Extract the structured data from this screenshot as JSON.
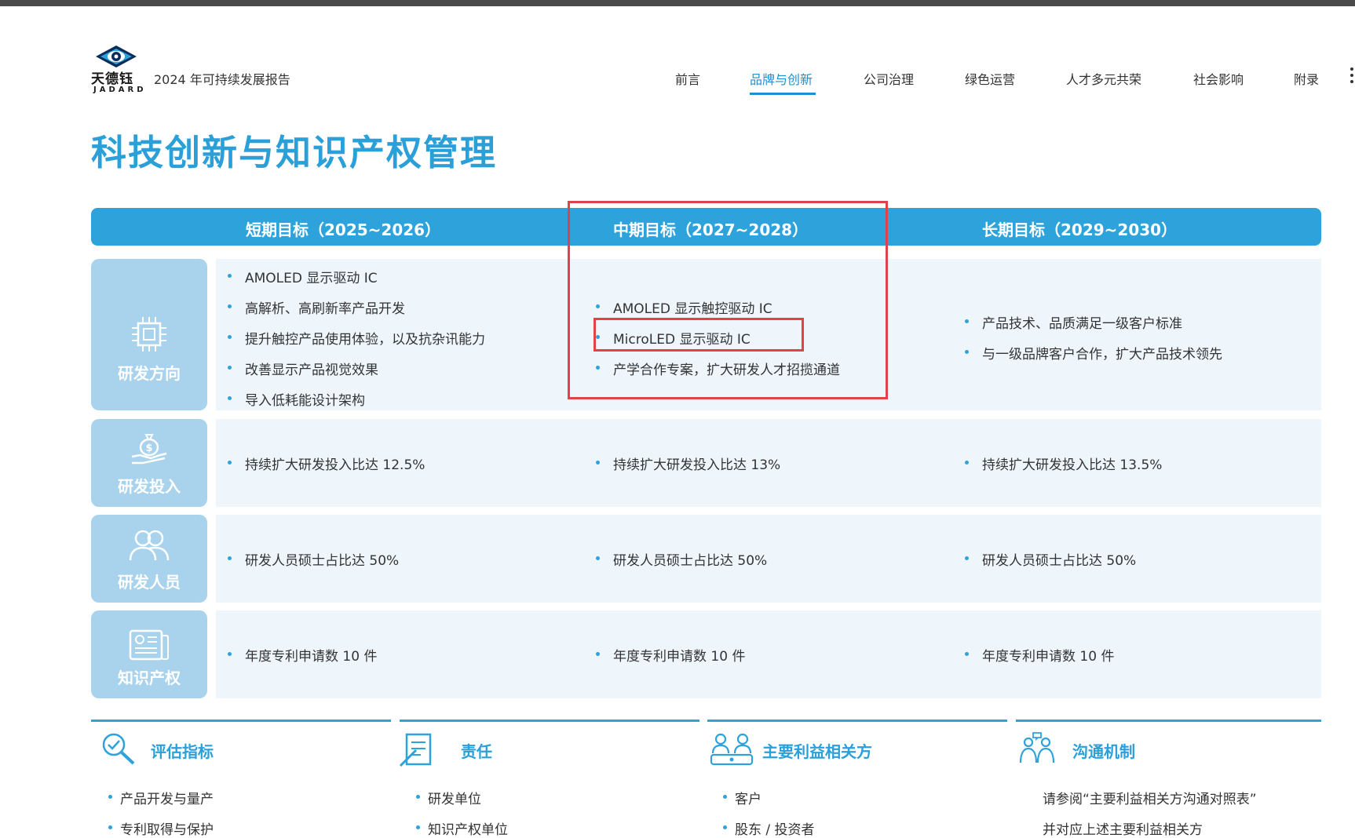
{
  "header": {
    "logo_text": "天德钰",
    "logo_sub": "JADARD",
    "report_title": "2024 年可持续发展报告"
  },
  "nav": {
    "items": [
      "前言",
      "品牌与创新",
      "公司治理",
      "绿色运营",
      "人才多元共荣",
      "社会影响",
      "附录"
    ],
    "active_index": 1
  },
  "page_title": "科技创新与知识产权管理",
  "table": {
    "columns": [
      "短期目标（2025~2026）",
      "中期目标（2027~2028）",
      "长期目标（2029~2030）"
    ],
    "rows": [
      {
        "label": "研发方向",
        "icon": "chip-icon",
        "short": [
          "AMOLED 显示驱动 IC",
          "高解析、高刷新率产品开发",
          "提升触控产品使用体验，以及抗杂讯能力",
          "改善显示产品视觉效果",
          "导入低耗能设计架构"
        ],
        "mid": [
          "AMOLED 显示触控驱动 IC",
          "MicroLED 显示驱动 IC",
          "产学合作专案，扩大研发人才招揽通道"
        ],
        "long": [
          "产品技术、品质满足一级客户标准",
          "与一级品牌客户合作，扩大产品技术领先"
        ]
      },
      {
        "label": "研发投入",
        "icon": "money-bag-hand-icon",
        "short": [
          "持续扩大研发投入比达 12.5%"
        ],
        "mid": [
          "持续扩大研发投入比达 13%"
        ],
        "long": [
          "持续扩大研发投入比达 13.5%"
        ]
      },
      {
        "label": "研发人员",
        "icon": "people-icon",
        "short": [
          "研发人员硕士占比达 50%"
        ],
        "mid": [
          "研发人员硕士占比达 50%"
        ],
        "long": [
          "研发人员硕士占比达 50%"
        ]
      },
      {
        "label": "知识产权",
        "icon": "document-icon",
        "short": [
          "年度专利申请数 10 件"
        ],
        "mid": [
          "年度专利申请数 10 件"
        ],
        "long": [
          "年度专利申请数 10 件"
        ]
      }
    ]
  },
  "sections": [
    {
      "title": "评估指标",
      "icon": "magnifier-check-icon",
      "items": [
        "产品开发与量产",
        "专利取得与保护"
      ]
    },
    {
      "title": "责任",
      "icon": "clipboard-pen-icon",
      "items": [
        "研发单位",
        "知识产权单位"
      ]
    },
    {
      "title": "主要利益相关方",
      "icon": "stakeholders-icon",
      "items": [
        "客户",
        "股东 / 投资者"
      ]
    },
    {
      "title": "沟通机制",
      "icon": "communication-icon",
      "items": [
        "请参阅“主要利益相关方沟通对照表”",
        "并对应上述主要利益相关方"
      ]
    }
  ],
  "colors": {
    "accent": "#2ea3db",
    "row_label_bg": "#a9d3ec",
    "row_body_bg": "#eef6fc",
    "highlight": "#e0424b"
  }
}
